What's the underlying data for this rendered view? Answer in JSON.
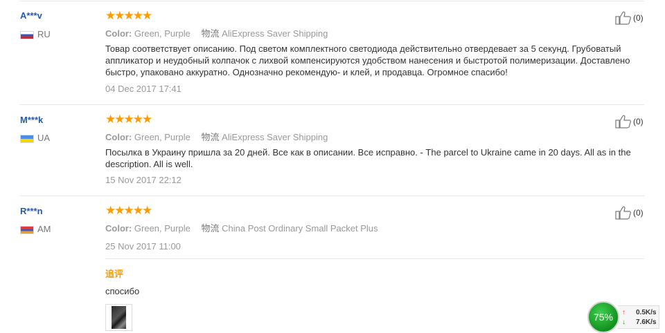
{
  "reviews": [
    {
      "user": "A***v",
      "country": "RU",
      "flag": "flag-ru",
      "rating": 5,
      "color_label": "Color:",
      "color_value": "Green, Purple",
      "logistics_label": "物流",
      "logistics_value": "AliExpress Saver Shipping",
      "feedback": "Товар соответствует описанию. Под светом комплектного светодиода действительно отвердевает за 5 секунд. Грубоватый аппликатор и неудобный колпачок с лихвой компенсируются удобством нанесения и быстротой полимеризации. Доставлено быстро, упаковано аккуратно. Однозначно рекомендую- и клей, и продавца. Огромное спасибо!",
      "date": "04 Dec 2017 17:41",
      "helpful_count": "(0)"
    },
    {
      "user": "M***k",
      "country": "UA",
      "flag": "flag-ua",
      "rating": 5,
      "color_label": "Color:",
      "color_value": "Green, Purple",
      "logistics_label": "物流",
      "logistics_value": "AliExpress Saver Shipping",
      "feedback": "Посылка в Украину пришла за 20 дней. Все как в описании. Все исправно. - The parcel to Ukraine came in 20 days. All as in the description. All is well.",
      "date": "15 Nov 2017 22:12",
      "helpful_count": "(0)"
    },
    {
      "user": "R***n",
      "country": "AM",
      "flag": "flag-am",
      "rating": 5,
      "color_label": "Color:",
      "color_value": "Green, Purple",
      "logistics_label": "物流",
      "logistics_value": "China Post Ordinary Small Packet Plus",
      "feedback": "",
      "date": "25 Nov 2017 11:00",
      "helpful_count": "(0)",
      "additional_label": "追评",
      "additional_text": "спосибо"
    }
  ],
  "speed_widget": {
    "percent": "75%",
    "upload": "0.5K/s",
    "download": "7.6K/s"
  },
  "colors": {
    "user_name": "#2559b0",
    "star": "#ff9a00",
    "meta_text": "#999999"
  }
}
